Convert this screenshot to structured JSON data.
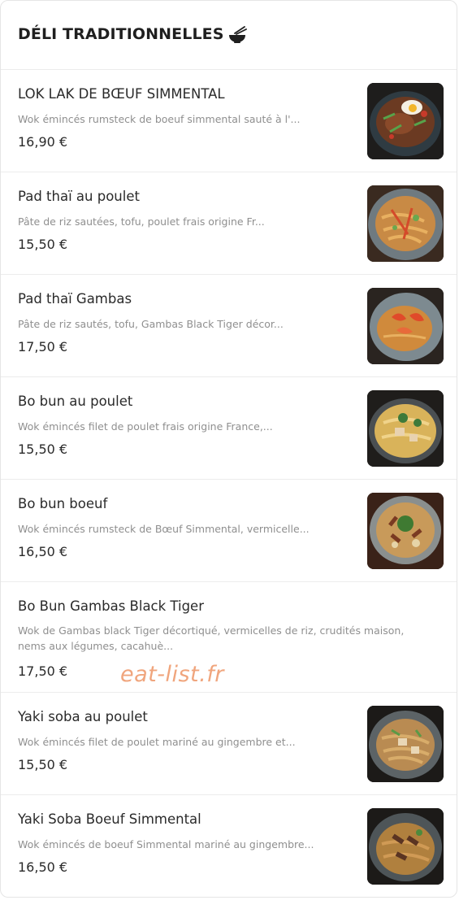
{
  "section": {
    "title": "DÉLI TRADITIONNELLES",
    "icon": "noodle-bowl-icon"
  },
  "items": [
    {
      "name": "LOK LAK DE BŒUF SIMMENTAL",
      "description": "Wok émincés rumsteck de boeuf simmental sauté à l'...",
      "price": "16,90 €",
      "image": "lok-lak-dish-photo"
    },
    {
      "name": "Pad thaï au poulet",
      "description": "Pâte de riz sautées, tofu, poulet frais origine Fr...",
      "price": "15,50 €",
      "image": "pad-thai-chicken-photo"
    },
    {
      "name": "Pad thaï Gambas",
      "description": "Pâte de riz sautés, tofu, Gambas Black Tiger décor...",
      "price": "17,50 €",
      "image": "pad-thai-prawns-photo"
    },
    {
      "name": "Bo bun au poulet",
      "description": "Wok émincés filet de poulet frais origine France,...",
      "price": "15,50 €",
      "image": "bo-bun-chicken-photo"
    },
    {
      "name": "Bo bun boeuf",
      "description": "Wok émincés rumsteck de Bœuf Simmental, vermicelle...",
      "price": "16,50 €",
      "image": "bo-bun-beef-photo"
    },
    {
      "name": "Bo Bun Gambas Black Tiger",
      "description": "Wok de Gambas black Tiger décortiqué, vermicelles de riz, crudités maison, nems aux légumes, cacahuè...",
      "price": "17,50 €",
      "image": ""
    },
    {
      "name": "Yaki soba au poulet",
      "description": "Wok émincés filet de poulet mariné au gingembre et...",
      "price": "15,50 €",
      "image": "yaki-soba-chicken-photo"
    },
    {
      "name": "Yaki Soba Boeuf Simmental",
      "description": "Wok émincés de boeuf Simmental mariné au gingembre...",
      "price": "16,50 €",
      "image": "yaki-soba-beef-photo"
    }
  ],
  "watermark": "eat-list.fr",
  "colors": {
    "text": "#2a2a2a",
    "description": "#8f8f8f",
    "divider": "#ececec",
    "watermark": "#f0a57d"
  }
}
